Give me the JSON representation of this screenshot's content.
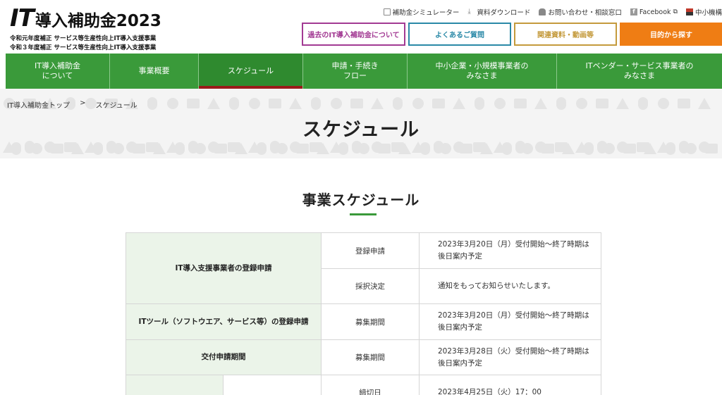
{
  "header": {
    "logo_it": "IT",
    "logo_text": "導入補助金2023",
    "sub1": "令和元年度補正 サービス等生産性向上IT導入支援事業",
    "sub2": "令和３年度補正 サービス等生産性向上IT導入支援事業",
    "links": [
      {
        "label": "補助金シミュレーター",
        "icon": "calculator-icon"
      },
      {
        "label": "資料ダウンロード",
        "icon": "download-icon"
      },
      {
        "label": "お問い合わせ・相談窓口",
        "icon": "user-icon"
      },
      {
        "label": "Facebook",
        "icon": "facebook-icon"
      },
      {
        "label": "中小機構",
        "icon": "flag-icon"
      }
    ],
    "buttons": [
      {
        "label": "過去のIT導入補助金について",
        "color": "#a23a93"
      },
      {
        "label": "よくあるご質問",
        "color": "#2a89a7"
      },
      {
        "label": "関連資料・動画等",
        "color": "#c49a3c"
      },
      {
        "label": "目的から探す",
        "color": "#ef7d14"
      }
    ]
  },
  "nav": [
    {
      "label": "IT導入補助金\nについて"
    },
    {
      "label": "事業概要"
    },
    {
      "label": "スケジュール"
    },
    {
      "label": "申請・手続き\nフロー"
    },
    {
      "label": "中小企業・小規模事業者の\nみなさま"
    },
    {
      "label": "ITベンダー・サービス事業者の\nみなさま"
    }
  ],
  "breadcrumb": {
    "home": "IT導入補助金トップ",
    "sep": ">",
    "current": "スケジュール"
  },
  "page_title": "スケジュール",
  "section_title": "事業スケジュール",
  "schedule": {
    "row1_head": "IT導入支援事業者の登録申請",
    "row1a_key": "登録申請",
    "row1a_val": "2023年3月20日（月）受付開始～終了時期は後日案内予定",
    "row1b_key": "採択決定",
    "row1b_val": "通知をもってお知らせいたします。",
    "row2_head": "ITツール（ソフトウエア、サービス等）の登録申請",
    "row2_key": "募集期間",
    "row2_val": "2023年3月20日（月）受付開始～終了時期は後日案内予定",
    "row3_head": "交付申請期間",
    "row3_key": "募集期間",
    "row3_val": "2023年3月28日（火）受付開始～終了時期は後日案内予定",
    "row4_key": "締切日",
    "row4_val": "2023年4月25日（火）17：00"
  },
  "colors": {
    "green": "#3a9a3a",
    "accent_red": "#9a1a1a",
    "table_head_bg": "#ebf4e9"
  }
}
